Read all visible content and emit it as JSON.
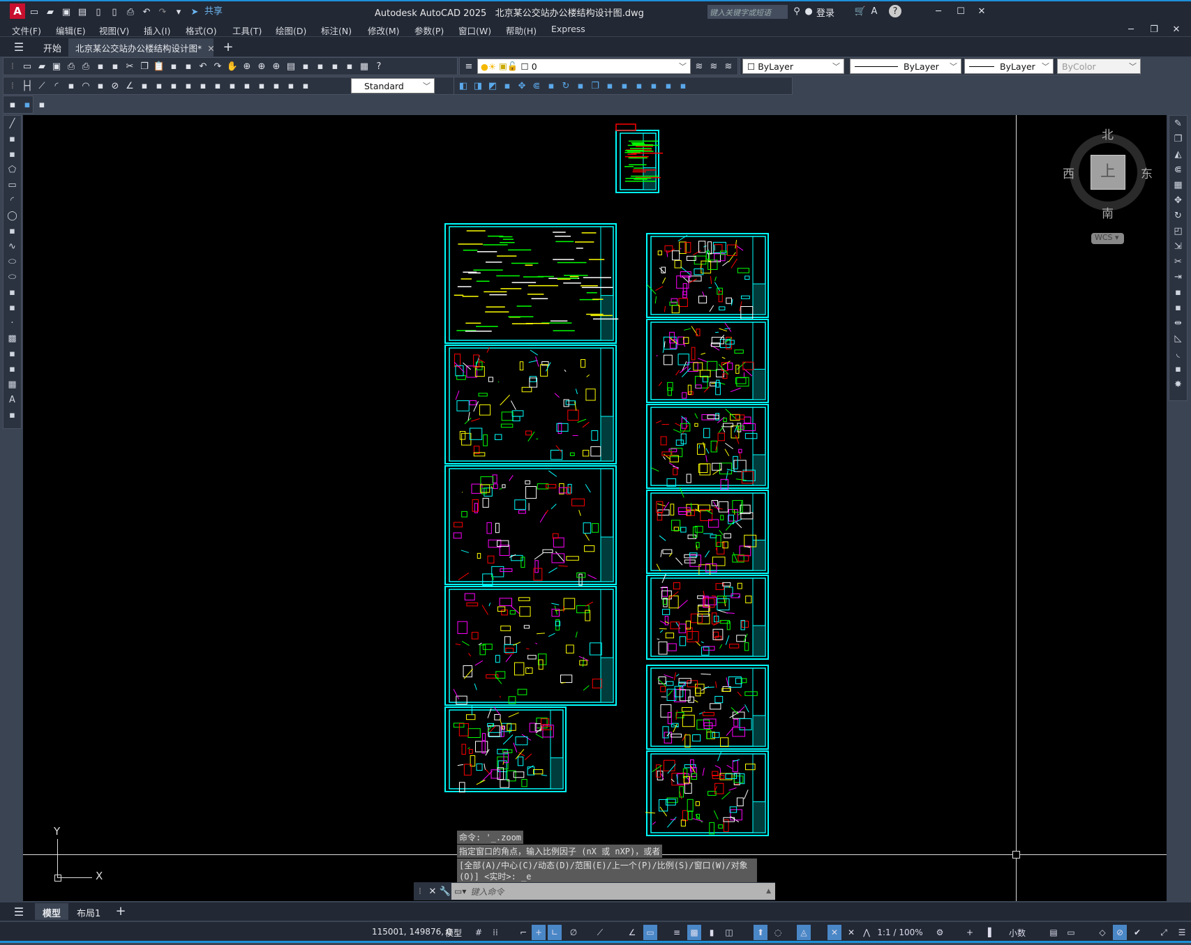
{
  "app": {
    "title": "Autodesk AutoCAD 2025",
    "file": "北京某公交站办公楼结构设计图.dwg",
    "share": "共享",
    "search_placeholder": "键入关键字或短语",
    "login": "登录"
  },
  "menu": [
    "文件(F)",
    "编辑(E)",
    "视图(V)",
    "插入(I)",
    "格式(O)",
    "工具(T)",
    "绘图(D)",
    "标注(N)",
    "修改(M)",
    "参数(P)",
    "窗口(W)",
    "帮助(H)",
    "Express"
  ],
  "tabs": {
    "start": "开始",
    "active": "北京某公交站办公楼结构设计图*"
  },
  "toolbar": {
    "row1_icons": [
      "new-icon",
      "open-icon",
      "save-icon",
      "print-icon",
      "print-preview-icon",
      "publish-icon",
      "dwf-icon",
      "cut-icon",
      "copy-icon",
      "paste-icon",
      "match-properties-icon",
      "block-editor-icon",
      "undo-icon",
      "redo-icon",
      "pan-icon",
      "zoom-realtime-icon",
      "zoom-window-icon",
      "zoom-previous-icon",
      "properties-icon",
      "design-center-icon",
      "tool-palette-icon",
      "sheet-set-icon",
      "markup-icon",
      "calculator-icon",
      "help-icon"
    ],
    "layer_value": "0",
    "color": "ByLayer",
    "linetype": "ByLayer",
    "lineweight": "ByLayer",
    "plotstyle": "ByColor",
    "row2_icons": [
      "linear-dim-icon",
      "aligned-dim-icon",
      "arc-length-icon",
      "ordinate-icon",
      "radius-icon",
      "jogged-icon",
      "diameter-icon",
      "angular-icon",
      "quick-dim-icon",
      "baseline-icon",
      "continue-icon",
      "space-icon",
      "break-icon",
      "tolerance-icon",
      "center-mark-icon",
      "inspect-icon",
      "jogged-linear-icon",
      "dim-edit-icon",
      "dim-text-edit-icon",
      "dim-update-icon"
    ],
    "dimstyle": "Standard",
    "row2b_icons": [
      "union-icon",
      "subtract-icon",
      "intersect-icon",
      "extrude-faces-icon",
      "move-faces-icon",
      "offset-faces-icon",
      "delete-faces-icon",
      "rotate-faces-icon",
      "taper-faces-icon",
      "copy-faces-icon",
      "color-faces-icon",
      "imprint-icon",
      "clean-icon",
      "separate-icon",
      "shell-icon",
      "check-icon"
    ],
    "row3_icons": [
      "attribute-edit-icon",
      "attribute-check-icon",
      "layer-states-icon"
    ]
  },
  "left_tools": [
    "line-icon",
    "construction-line-icon",
    "polyline-icon",
    "polygon-icon",
    "rectangle-icon",
    "arc-icon",
    "circle-icon",
    "revision-cloud-icon",
    "spline-icon",
    "ellipse-icon",
    "ellipse-arc-icon",
    "insert-block-icon",
    "make-block-icon",
    "point-icon",
    "hatch-icon",
    "gradient-icon",
    "region-icon",
    "table-icon",
    "multiline-text-icon",
    "add-selected-icon"
  ],
  "right_tools": [
    "erase-icon",
    "copy-object-icon",
    "mirror-icon",
    "offset-icon",
    "array-icon",
    "move-icon",
    "rotate-icon",
    "scale-icon",
    "stretch-icon",
    "trim-icon",
    "extend-icon",
    "break-at-point-icon",
    "break-icon",
    "join-icon",
    "chamfer-icon",
    "fillet-icon",
    "blend-icon",
    "explode-icon"
  ],
  "viewcube": {
    "north": "北",
    "south": "南",
    "east": "东",
    "west": "西",
    "top": "上",
    "wcs": "WCS"
  },
  "ucs": {
    "x": "X",
    "y": "Y"
  },
  "command": {
    "history": [
      "命令: '_.zoom",
      "指定窗口的角点，输入比例因子 (nX 或 nXP)，或者",
      "[全部(A)/中心(C)/动态(D)/范围(E)/上一个(P)/比例(S)/窗口(W)/对象",
      "(O)] <实时>: _e"
    ],
    "placeholder": "键入命令"
  },
  "layout_tabs": [
    "模型",
    "布局1"
  ],
  "status": {
    "coords": "115001, 149876, 0",
    "model": "模型",
    "scale": "1:1 / 100%",
    "units": "小数"
  },
  "colors": {
    "frame": "#00ffff",
    "accent": "#1e90d8",
    "bg": "#000000"
  }
}
